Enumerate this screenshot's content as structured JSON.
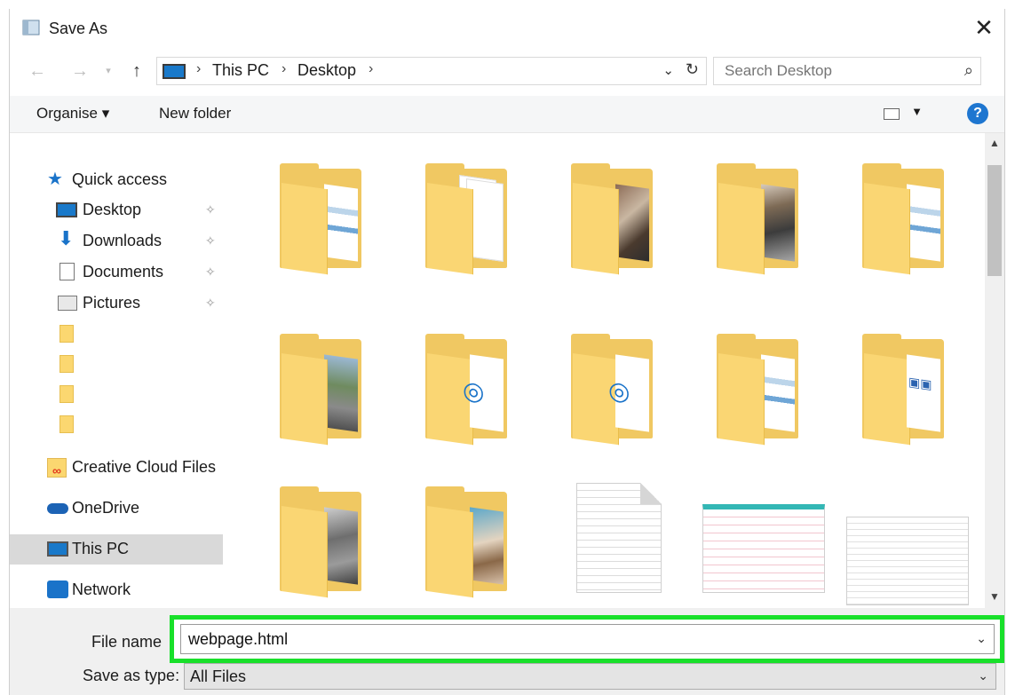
{
  "window": {
    "title": "Save As",
    "close_icon": "close-icon"
  },
  "address": {
    "crumbs": [
      "This PC",
      "Desktop"
    ],
    "search_placeholder": "Search Desktop"
  },
  "toolbar": {
    "organise": "Organise ▾",
    "new_folder": "New folder",
    "help": "?"
  },
  "sidebar": {
    "items": [
      {
        "label": "Quick access",
        "icon": "star-icon"
      },
      {
        "label": "Desktop",
        "icon": "desktop-icon",
        "pinned": true
      },
      {
        "label": "Downloads",
        "icon": "download-arrow-icon",
        "pinned": true
      },
      {
        "label": "Documents",
        "icon": "document-icon",
        "pinned": true
      },
      {
        "label": "Pictures",
        "icon": "pictures-icon",
        "pinned": true
      },
      {
        "label": "Creative Cloud Files",
        "icon": "creative-cloud-icon"
      },
      {
        "label": "OneDrive",
        "icon": "cloud-icon"
      },
      {
        "label": "This PC",
        "icon": "pc-icon",
        "selected": true
      },
      {
        "label": "Network",
        "icon": "network-icon"
      }
    ]
  },
  "files": {
    "row1": [
      "folder-docs",
      "folder-blank",
      "folder-photo",
      "folder-photo",
      "folder-docs"
    ],
    "row2": [
      "folder-city",
      "folder-ring",
      "folder-ring",
      "folder-docs",
      "folder-cubes"
    ],
    "row3": [
      "folder-gray",
      "folder-beach",
      "text-document",
      "spreadsheet",
      "text-sheet"
    ]
  },
  "bottom": {
    "filename_label": "File name",
    "filename_value": "webpage.html",
    "savetype_label": "Save as type:",
    "savetype_value": "All Files"
  },
  "colors": {
    "highlight": "#18e02a",
    "accent": "#1979ca",
    "folder": "#f0c862"
  }
}
